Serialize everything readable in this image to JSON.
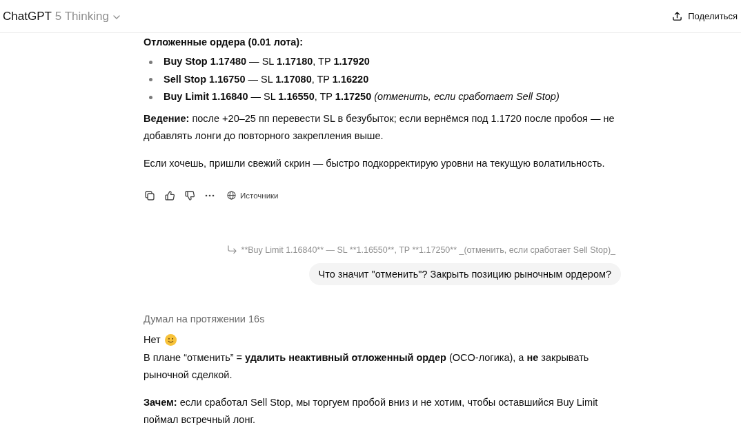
{
  "header": {
    "title": "ChatGPT",
    "model": "5 Thinking",
    "share_label": "Поделиться"
  },
  "conversation": [
    {
      "kind": "assistant",
      "blocks": [
        {
          "kind": "heading",
          "text": "Отложенные ордера (0.01 лота):"
        },
        {
          "kind": "list",
          "items": [
            "**Buy Stop 1.17480** — SL **1.17180**, TP **1.17920**",
            "**Sell Stop 1.16750** — SL **1.17080**, TP **1.16220**",
            "**Buy Limit 1.16840** — SL **1.16550**, TP **1.17250** *(отменить, если сработает Sell Stop)*"
          ]
        },
        {
          "kind": "paragraph",
          "text": "**Ведение:** после +20–25 пп перевести SL в безубыток; если вернёмся под 1.1720 после пробоя — не добавлять лонги до повторного закрепления выше."
        },
        {
          "kind": "paragraph",
          "text": "Если хочешь, пришли свежий скрин — быстро подкорректирую уровни на текущую волатильность."
        }
      ],
      "actions": {
        "sources_label": "Источники"
      }
    },
    {
      "kind": "user",
      "quote": "**Buy Limit 1.16840** — SL **1.16550**, TP **1.17250** _(отменить, если сработает Sell Stop)_",
      "text": "Что значит \"отменить\"? Закрыть позицию рыночным ордером?"
    },
    {
      "kind": "assistant",
      "thought_label": "Думал на протяжении 16s",
      "blocks": [
        {
          "kind": "text_with_smiley",
          "text": "Нет"
        },
        {
          "kind": "paragraph",
          "text": "В плане “отменить” = **удалить неактивный отложенный ордер** (OCO-логика), а **не** закрывать рыночной сделкой."
        },
        {
          "kind": "paragraph",
          "text": "**Зачем:** если сработал Sell Stop, мы торгуем пробой вниз и не хотим, чтобы оставшийся Buy Limit поймал встречный лонг."
        }
      ]
    }
  ]
}
